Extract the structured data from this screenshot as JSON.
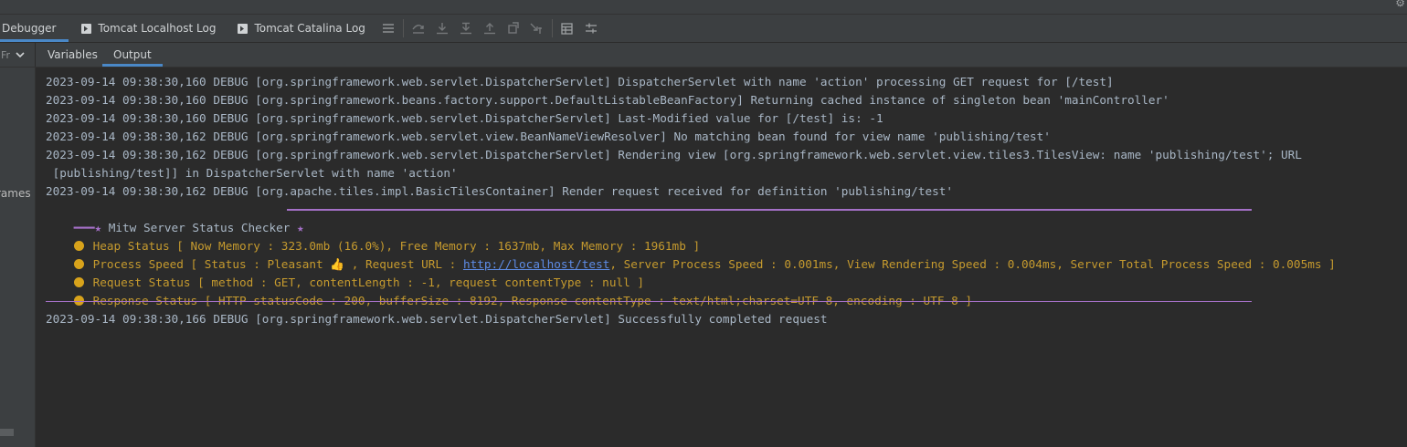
{
  "colors": {
    "panel": "#3c3f41",
    "console_bg": "#2b2b2b",
    "log_text": "#a9b7c6",
    "status_text": "#c59a2e",
    "banner": "#a470c7",
    "link": "#5e8ce6",
    "active_tab_underline": "#4a88c7"
  },
  "tabs": [
    {
      "label": "Debugger",
      "active": true
    },
    {
      "label": "Tomcat Localhost Log",
      "icon": "log-file-icon"
    },
    {
      "label": "Tomcat Catalina Log",
      "icon": "log-file-icon"
    }
  ],
  "toolbar_icons": [
    "menu-lines-icon",
    "step-over-icon",
    "step-into-icon",
    "force-step-into-icon",
    "step-out-icon",
    "drop-frame-icon",
    "run-to-cursor-icon",
    "evaluate-expression-icon",
    "settings-icon"
  ],
  "subtabs": [
    {
      "label": "Variables"
    },
    {
      "label": "Output",
      "active": true
    }
  ],
  "frames_label": "Fr",
  "frames_text": "rames a",
  "log_lines": [
    "2023-09-14 09:38:30,160 DEBUG [org.springframework.web.servlet.DispatcherServlet] DispatcherServlet with name 'action' processing GET request for [/test]",
    "2023-09-14 09:38:30,160 DEBUG [org.springframework.beans.factory.support.DefaultListableBeanFactory] Returning cached instance of singleton bean 'mainController'",
    "2023-09-14 09:38:30,160 DEBUG [org.springframework.web.servlet.DispatcherServlet] Last-Modified value for [/test] is: -1",
    "2023-09-14 09:38:30,162 DEBUG [org.springframework.web.servlet.view.BeanNameViewResolver] No matching bean found for view name 'publishing/test'",
    "2023-09-14 09:38:30,162 DEBUG [org.springframework.web.servlet.DispatcherServlet] Rendering view [org.springframework.web.servlet.view.tiles3.TilesView: name 'publishing/test'; URL",
    " [publishing/test]] in DispatcherServlet with name 'action'",
    "2023-09-14 09:38:30,162 DEBUG [org.apache.tiles.impl.BasicTilesContainer] Render request received for definition 'publishing/test'"
  ],
  "banner": {
    "prefix": "━━━★ ",
    "title": "Mitw Server Status Checker",
    "suffix": " ★"
  },
  "status": {
    "heap": "Heap Status [ Now Memory : 323.0mb (16.0%), Free Memory : 1637mb, Max Memory : 1961mb ]",
    "process_before": "Process Speed [ Status : Pleasant 👍 , Request URL : ",
    "process_url": "http://localhost/test",
    "process_after": ", Server Process Speed : 0.001ms, View Rendering Speed : 0.004ms, Server Total Process Speed : 0.005ms ]",
    "request": "Request Status [ method : GET, contentLength : -1, request contentType : null ]",
    "response": "Response Status [ HTTP statusCode : 200, bufferSize : 8192, Response contentType : text/html;charset=UTF-8, encoding : UTF-8 ]"
  },
  "final_line": "2023-09-14 09:38:30,166 DEBUG [org.springframework.web.servlet.DispatcherServlet] Successfully completed request"
}
